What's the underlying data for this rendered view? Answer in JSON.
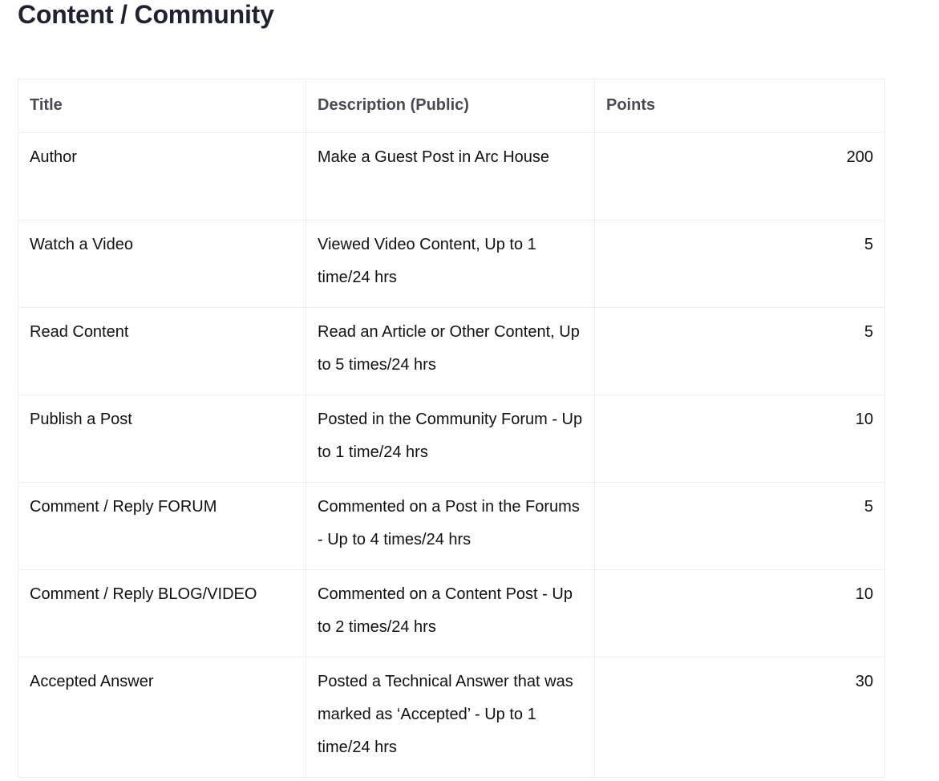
{
  "page": {
    "title": "Content / Community"
  },
  "table": {
    "headers": [
      "Title",
      "Description (Public)",
      "Points"
    ],
    "rows": [
      {
        "title": "Author",
        "description": "Make a Guest Post in Arc House",
        "points": "200"
      },
      {
        "title": "Watch a Video",
        "description": "Viewed Video Content, Up to 1 time/24 hrs",
        "points": "5"
      },
      {
        "title": "Read Content",
        "description": "Read an Article or Other Content, Up to 5 times/24 hrs",
        "points": "5"
      },
      {
        "title": "Publish a Post",
        "description": "Posted in the Community Forum - Up to 1 time/24 hrs",
        "points": "10"
      },
      {
        "title": "Comment / Reply FORUM",
        "description": "Commented on a Post in the Forums - Up to 4 times/24 hrs",
        "points": "5"
      },
      {
        "title": "Comment / Reply BLOG/VIDEO",
        "description": "Commented on a Content Post - Up to 2 times/24 hrs",
        "points": "10"
      },
      {
        "title": "Accepted Answer",
        "description": "Posted a Technical Answer that was marked as ‘Accepted’ - Up to 1 time/24 hrs",
        "points": "30"
      }
    ]
  }
}
